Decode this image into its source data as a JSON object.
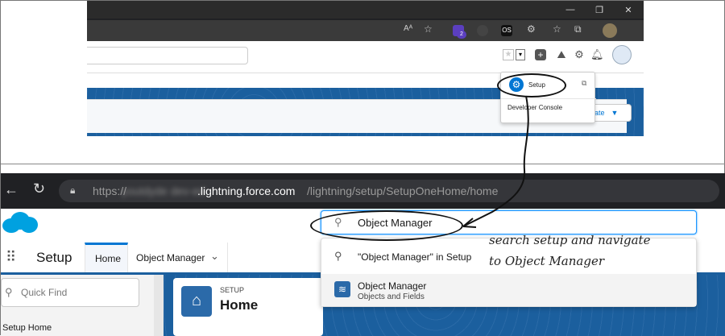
{
  "top": {
    "window_controls": [
      "—",
      "❐",
      "✕"
    ],
    "extension_badge": "2",
    "ext_os_label": "OS",
    "gear_menu": {
      "setup_label": "Setup",
      "dev_console_label": "Developer Console"
    },
    "create_button_label": "eate"
  },
  "bottom": {
    "url_prefix": "https://",
    "url_blurred": "youtdyde dev-ed",
    "url_domain": ".lightning.force.com",
    "url_path": "/lightning/setup/SetupOneHome/home",
    "search_value": "Object Manager",
    "app_name": "Setup",
    "tabs": [
      {
        "label": "Home"
      },
      {
        "label": "Object Manager"
      }
    ],
    "dropdown": {
      "search_suggestion": "\"Object Manager\" in Setup",
      "result_title": "Object Manager",
      "result_subtitle": "Objects and Fields"
    },
    "quick_find_placeholder": "Quick Find",
    "sidebar_first_item": "Setup Home",
    "card_eyebrow": "SETUP",
    "card_title": "Home"
  },
  "annotation": {
    "line1": "search setup and navigate",
    "line2": "to Object Manager"
  },
  "colors": {
    "salesforce_blue": "#1b96ff",
    "band_blue": "#1b5f9e",
    "browser_dark": "#202124"
  }
}
